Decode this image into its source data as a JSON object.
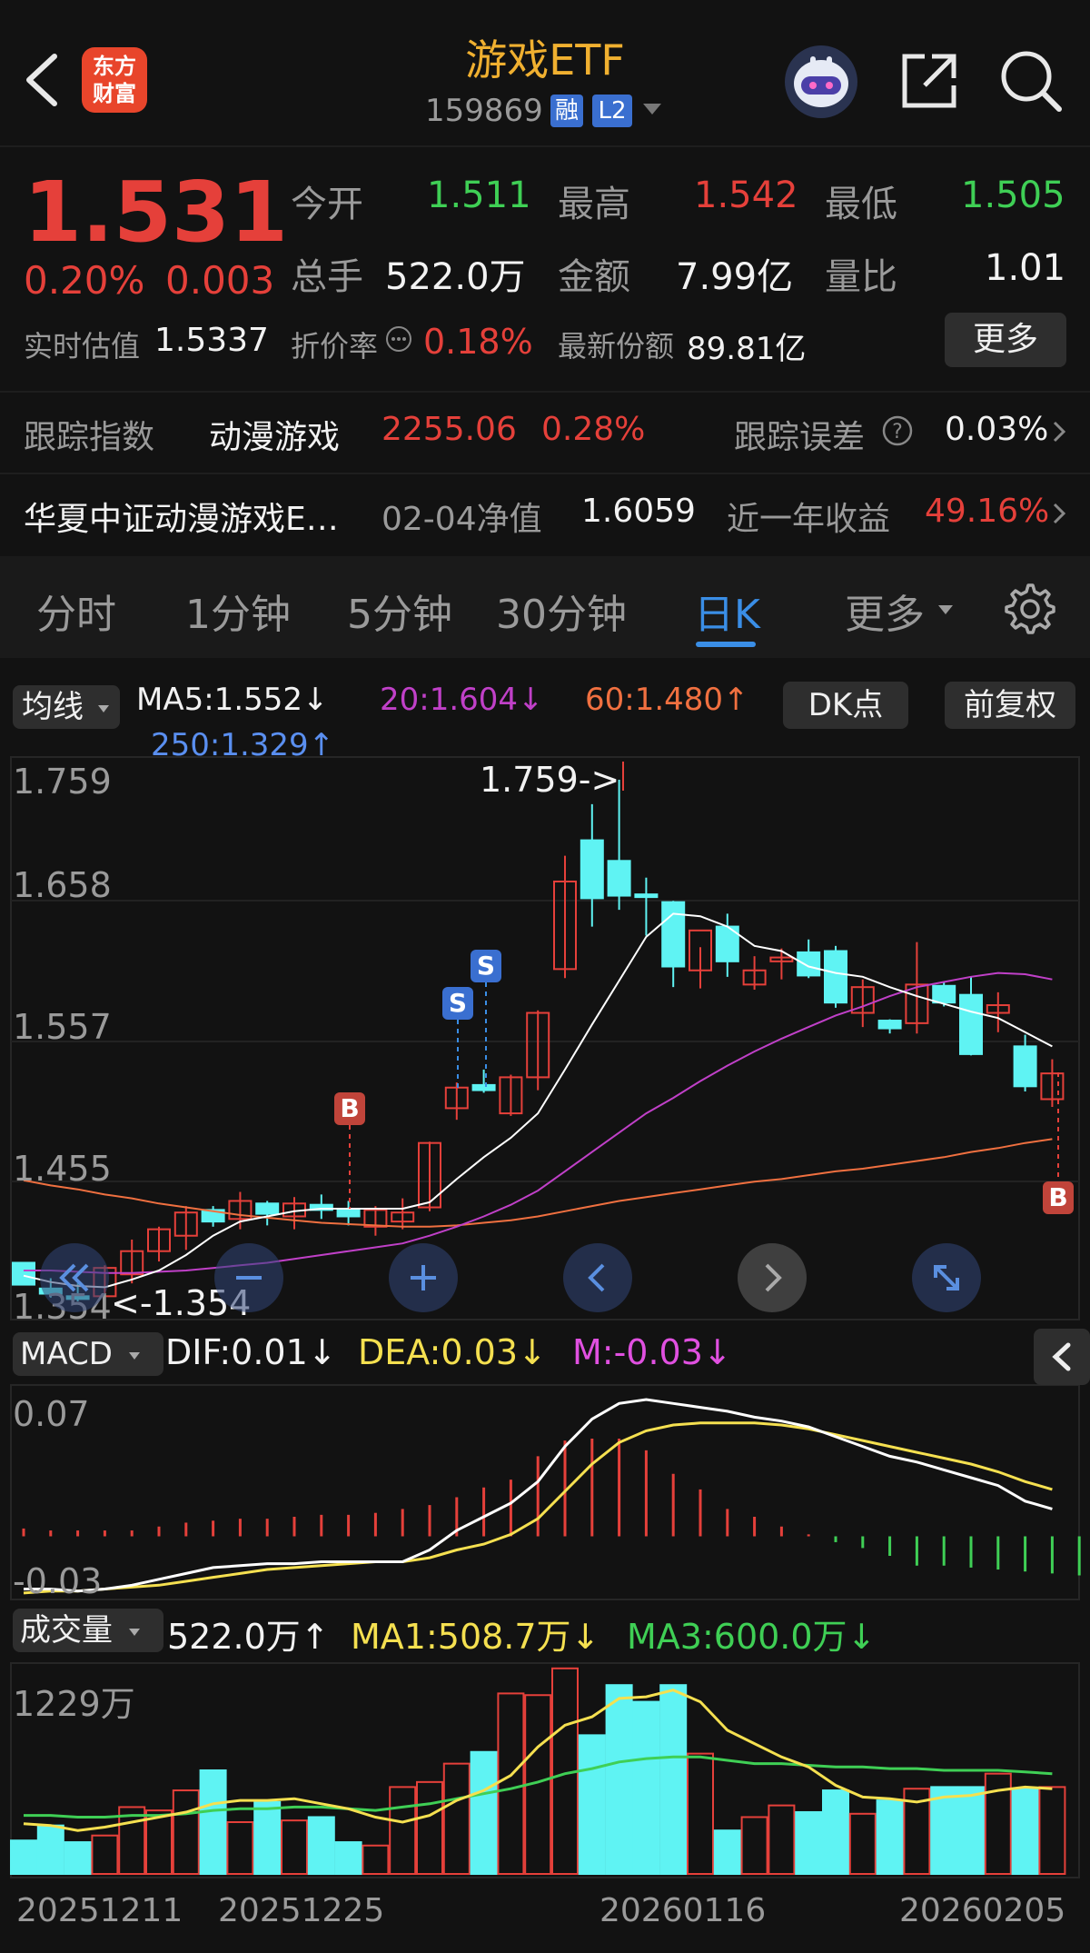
{
  "header": {
    "title": "游戏ETF",
    "code": "159869",
    "tag_rong": "融",
    "tag_level": "L2",
    "logo_line1": "东方",
    "logo_line2": "财富"
  },
  "quote": {
    "price": "1.531",
    "change_pct": "0.20%",
    "change": "0.003",
    "open_label": "今开",
    "open": "1.511",
    "high_label": "最高",
    "high": "1.542",
    "low_label": "最低",
    "low": "1.505",
    "volume_label": "总手",
    "volume": "522.0万",
    "amount_label": "金额",
    "amount": "7.99亿",
    "ratio_label": "量比",
    "ratio": "1.01",
    "iopv_label": "实时估值",
    "iopv": "1.5337",
    "discount_label": "折价率",
    "discount": "0.18%",
    "shares_label": "最新份额",
    "shares": "89.81亿",
    "more_button": "更多"
  },
  "tracking": {
    "label": "跟踪指数",
    "index": "动漫游戏",
    "value": "2255.06",
    "pct": "0.28%",
    "error_label": "跟踪误差",
    "error": "0.03%"
  },
  "fund": {
    "name": "华夏中证动漫游戏E…",
    "nav_label": "02-04净值",
    "nav": "1.6059",
    "return_label": "近一年收益",
    "return": "49.16%"
  },
  "tabs": [
    "分时",
    "1分钟",
    "5分钟",
    "30分钟",
    "日K",
    "更多"
  ],
  "active_tab": 4,
  "ma_bar": {
    "select": "均线",
    "ma5": "MA5:1.552↓",
    "ma20": "20:1.604↓",
    "ma60": "60:1.480↑",
    "ma250": "250:1.329↑",
    "dk_button": "DK点",
    "adjust_button": "前复权"
  },
  "kline": {
    "y_labels": [
      "1.759",
      "1.658",
      "1.557",
      "1.455",
      "1.354"
    ],
    "high_note": "1.759->",
    "low_note": "<-1.354",
    "signal_s": "S",
    "signal_b": "B"
  },
  "macd": {
    "select": "MACD",
    "dif": "DIF:0.01↓",
    "dea": "DEA:0.03↓",
    "m": "M:-0.03↓",
    "y_top": "0.07",
    "y_bottom": "-0.03"
  },
  "vol": {
    "select": "成交量",
    "value": "522.0万↑",
    "ma1": "MA1:508.7万↓",
    "ma3": "MA3:600.0万↓",
    "y_top": "1229万"
  },
  "x_dates": [
    "20251211",
    "20251225",
    "20260116",
    "20260205"
  ],
  "colors": {
    "up": "#e5403a",
    "down": "#5ff3f3",
    "ma5": "#ffffff",
    "ma20": "#c040c8",
    "ma60": "#f07040",
    "ma250": "#5a8ff0",
    "dea": "#f5e050",
    "ma3": "#3fcf55",
    "accent": "#3a8ee6"
  },
  "chart_data": {
    "type": "candlestick",
    "candles": [
      {
        "o": 1.384,
        "h": 1.384,
        "l": 1.367,
        "c": 1.367
      },
      {
        "o": 1.364,
        "h": 1.372,
        "l": 1.357,
        "c": 1.36
      },
      {
        "o": 1.358,
        "h": 1.368,
        "l": 1.354,
        "c": 1.356
      },
      {
        "o": 1.358,
        "h": 1.382,
        "l": 1.356,
        "c": 1.38
      },
      {
        "o": 1.375,
        "h": 1.402,
        "l": 1.368,
        "c": 1.393
      },
      {
        "o": 1.393,
        "h": 1.412,
        "l": 1.385,
        "c": 1.41
      },
      {
        "o": 1.405,
        "h": 1.428,
        "l": 1.394,
        "c": 1.423
      },
      {
        "o": 1.425,
        "h": 1.428,
        "l": 1.412,
        "c": 1.416
      },
      {
        "o": 1.418,
        "h": 1.439,
        "l": 1.41,
        "c": 1.432
      },
      {
        "o": 1.43,
        "h": 1.432,
        "l": 1.413,
        "c": 1.422
      },
      {
        "o": 1.42,
        "h": 1.435,
        "l": 1.41,
        "c": 1.43
      },
      {
        "o": 1.429,
        "h": 1.437,
        "l": 1.418,
        "c": 1.425
      },
      {
        "o": 1.425,
        "h": 1.432,
        "l": 1.413,
        "c": 1.42
      },
      {
        "o": 1.412,
        "h": 1.428,
        "l": 1.405,
        "c": 1.425
      },
      {
        "o": 1.416,
        "h": 1.434,
        "l": 1.41,
        "c": 1.423
      },
      {
        "o": 1.427,
        "h": 1.478,
        "l": 1.424,
        "c": 1.477
      },
      {
        "o": 1.504,
        "h": 1.524,
        "l": 1.495,
        "c": 1.52
      },
      {
        "o": 1.522,
        "h": 1.534,
        "l": 1.516,
        "c": 1.518
      },
      {
        "o": 1.5,
        "h": 1.53,
        "l": 1.498,
        "c": 1.528
      },
      {
        "o": 1.528,
        "h": 1.58,
        "l": 1.518,
        "c": 1.578
      },
      {
        "o": 1.612,
        "h": 1.7,
        "l": 1.605,
        "c": 1.68
      },
      {
        "o": 1.712,
        "h": 1.74,
        "l": 1.645,
        "c": 1.667
      },
      {
        "o": 1.696,
        "h": 1.759,
        "l": 1.658,
        "c": 1.669
      },
      {
        "o": 1.67,
        "h": 1.683,
        "l": 1.638,
        "c": 1.668
      },
      {
        "o": 1.664,
        "h": 1.665,
        "l": 1.598,
        "c": 1.614
      },
      {
        "o": 1.611,
        "h": 1.629,
        "l": 1.597,
        "c": 1.642
      },
      {
        "o": 1.645,
        "h": 1.655,
        "l": 1.606,
        "c": 1.618
      },
      {
        "o": 1.6,
        "h": 1.622,
        "l": 1.596,
        "c": 1.611
      },
      {
        "o": 1.618,
        "h": 1.628,
        "l": 1.604,
        "c": 1.621
      },
      {
        "o": 1.625,
        "h": 1.635,
        "l": 1.605,
        "c": 1.607
      },
      {
        "o": 1.626,
        "h": 1.63,
        "l": 1.582,
        "c": 1.586
      },
      {
        "o": 1.578,
        "h": 1.604,
        "l": 1.567,
        "c": 1.598
      },
      {
        "o": 1.572,
        "h": 1.573,
        "l": 1.562,
        "c": 1.566
      },
      {
        "o": 1.57,
        "h": 1.633,
        "l": 1.562,
        "c": 1.6
      },
      {
        "o": 1.599,
        "h": 1.602,
        "l": 1.583,
        "c": 1.586
      },
      {
        "o": 1.592,
        "h": 1.606,
        "l": 1.545,
        "c": 1.546
      },
      {
        "o": 1.578,
        "h": 1.594,
        "l": 1.563,
        "c": 1.584
      },
      {
        "o": 1.552,
        "h": 1.561,
        "l": 1.517,
        "c": 1.521
      },
      {
        "o": 1.511,
        "h": 1.542,
        "l": 1.505,
        "c": 1.531
      }
    ],
    "ma5": [
      1.374,
      1.369,
      1.366,
      1.365,
      1.371,
      1.378,
      1.39,
      1.405,
      1.416,
      1.42,
      1.424,
      1.426,
      1.426,
      1.426,
      1.426,
      1.431,
      1.449,
      1.466,
      1.481,
      1.5,
      1.534,
      1.569,
      1.603,
      1.637,
      1.655,
      1.653,
      1.645,
      1.63,
      1.626,
      1.614,
      1.609,
      1.606,
      1.598,
      1.591,
      1.585,
      1.579,
      1.574,
      1.563,
      1.552
    ],
    "ma20": [
      1.378,
      1.378,
      1.377,
      1.376,
      1.376,
      1.377,
      1.378,
      1.38,
      1.382,
      1.384,
      1.387,
      1.39,
      1.393,
      1.396,
      1.399,
      1.405,
      1.412,
      1.42,
      1.429,
      1.44,
      1.455,
      1.47,
      1.485,
      1.5,
      1.512,
      1.525,
      1.537,
      1.548,
      1.558,
      1.567,
      1.576,
      1.583,
      1.591,
      1.598,
      1.602,
      1.606,
      1.609,
      1.608,
      1.604
    ],
    "ma60": [
      1.448,
      1.444,
      1.441,
      1.437,
      1.434,
      1.43,
      1.427,
      1.424,
      1.421,
      1.419,
      1.417,
      1.415,
      1.414,
      1.413,
      1.412,
      1.412,
      1.413,
      1.415,
      1.417,
      1.42,
      1.424,
      1.428,
      1.432,
      1.435,
      1.438,
      1.441,
      1.444,
      1.447,
      1.449,
      1.452,
      1.455,
      1.457,
      1.46,
      1.463,
      1.466,
      1.47,
      1.473,
      1.477,
      1.48
    ],
    "macd_dif": [
      -0.027,
      -0.027,
      -0.028,
      -0.027,
      -0.025,
      -0.022,
      -0.019,
      -0.016,
      -0.015,
      -0.014,
      -0.014,
      -0.013,
      -0.013,
      -0.013,
      -0.013,
      -0.007,
      0.003,
      0.01,
      0.017,
      0.028,
      0.046,
      0.06,
      0.068,
      0.07,
      0.068,
      0.066,
      0.064,
      0.061,
      0.059,
      0.056,
      0.051,
      0.046,
      0.041,
      0.038,
      0.034,
      0.03,
      0.026,
      0.018,
      0.014
    ],
    "macd_dea": [
      -0.029,
      -0.028,
      -0.028,
      -0.027,
      -0.026,
      -0.025,
      -0.023,
      -0.021,
      -0.019,
      -0.017,
      -0.016,
      -0.015,
      -0.014,
      -0.013,
      -0.013,
      -0.011,
      -0.007,
      -0.004,
      0.001,
      0.009,
      0.023,
      0.037,
      0.048,
      0.054,
      0.057,
      0.058,
      0.058,
      0.058,
      0.057,
      0.055,
      0.052,
      0.049,
      0.046,
      0.043,
      0.04,
      0.037,
      0.033,
      0.028,
      0.024
    ],
    "macd_hist": [
      0.004,
      0.003,
      0.003,
      0.003,
      0.003,
      0.005,
      0.007,
      0.008,
      0.009,
      0.009,
      0.01,
      0.011,
      0.011,
      0.012,
      0.014,
      0.016,
      0.02,
      0.025,
      0.029,
      0.041,
      0.049,
      0.05,
      0.05,
      0.044,
      0.032,
      0.024,
      0.014,
      0.01,
      0.005,
      0.001,
      -0.003,
      -0.006,
      -0.01,
      -0.015,
      -0.015,
      -0.016,
      -0.017,
      -0.018,
      -0.019,
      -0.02
    ],
    "volume": [
      2.0,
      2.9,
      1.9,
      2.3,
      4.0,
      3.8,
      5.0,
      6.2,
      3.1,
      4.3,
      3.2,
      3.4,
      1.9,
      1.7,
      5.2,
      5.5,
      6.6,
      7.3,
      10.8,
      10.7,
      12.3,
      8.3,
      11.3,
      10.3,
      11.3,
      7.2,
      2.6,
      3.4,
      4.1,
      3.7,
      5.0,
      3.6,
      4.4,
      5.1,
      5.2,
      5.2,
      6.0,
      5.1,
      5.2
    ],
    "vol_ma1": [
      3.0,
      2.9,
      2.6,
      2.8,
      3.1,
      3.4,
      3.7,
      4.2,
      4.4,
      4.4,
      4.5,
      4.2,
      3.9,
      3.4,
      3.1,
      3.5,
      4.4,
      5.0,
      5.9,
      7.6,
      8.9,
      9.4,
      10.5,
      10.6,
      11.0,
      10.3,
      8.6,
      7.8,
      7.0,
      6.4,
      5.3,
      4.6,
      4.5,
      4.3,
      4.6,
      4.7,
      5.0,
      5.2,
      5.1
    ],
    "vol_ma3": [
      3.5,
      3.5,
      3.4,
      3.4,
      3.5,
      3.5,
      3.6,
      3.8,
      3.9,
      3.9,
      4.0,
      4.0,
      3.9,
      3.8,
      4.0,
      4.2,
      4.5,
      4.8,
      5.1,
      5.5,
      6.0,
      6.3,
      6.7,
      6.9,
      7.0,
      7.0,
      6.8,
      6.6,
      6.6,
      6.5,
      6.4,
      6.4,
      6.3,
      6.3,
      6.2,
      6.2,
      6.2,
      6.1,
      6.0
    ],
    "y_range": [
      1.354,
      1.759
    ],
    "macd_range": [
      -0.03,
      0.07
    ],
    "vol_max": 12.29
  }
}
